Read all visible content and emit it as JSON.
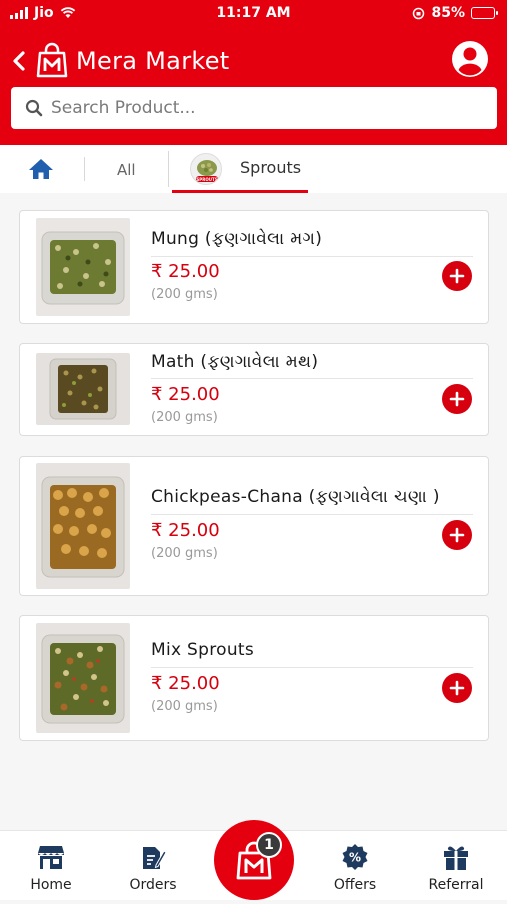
{
  "status_bar": {
    "carrier": "Jio",
    "time": "11:17 AM",
    "battery": "85%",
    "battery_level": 0.85
  },
  "header": {
    "back_icon": "chevron-left-icon",
    "logo_icon": "shopping-bag-m-icon",
    "title": "Mera Market",
    "profile_icon": "user-circle-icon"
  },
  "search": {
    "placeholder": "Search Product...",
    "value": ""
  },
  "tabs": {
    "home_icon": "home-icon",
    "all_label": "All",
    "active_label": "Sprouts",
    "active_badge_text": "SPROUTS"
  },
  "products": [
    {
      "name": "Mung (ફણગાવેલા મગ)",
      "price": "₹ 25.00",
      "unit": "(200 gms)",
      "add_icon": "plus-circle-icon"
    },
    {
      "name": "Math (ફણગાવેલા મથ)",
      "price": "₹ 25.00",
      "unit": "(200 gms)",
      "add_icon": "plus-circle-icon"
    },
    {
      "name": "Chickpeas-Chana (ફણગાવેલા ચણા )",
      "price": "₹ 25.00",
      "unit": "(200 gms)",
      "add_icon": "plus-circle-icon"
    },
    {
      "name": "Mix Sprouts",
      "price": "₹ 25.00",
      "unit": "(200 gms)",
      "add_icon": "plus-circle-icon"
    }
  ],
  "bottom_nav": {
    "home": "Home",
    "orders": "Orders",
    "offers": "Offers",
    "referral": "Referral",
    "cart_count": "1"
  },
  "colors": {
    "brand_red": "#e4000f",
    "price_red": "#d6000e"
  }
}
